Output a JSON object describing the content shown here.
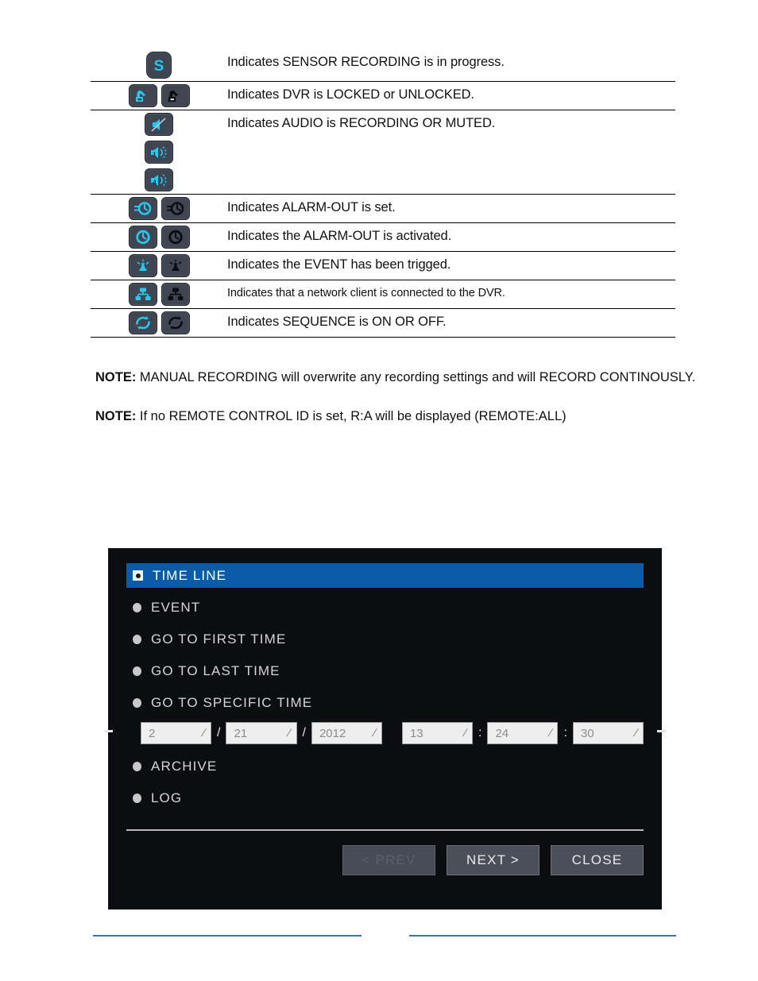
{
  "icon_table": {
    "rows": [
      {
        "id": "sensor-recording",
        "description": "Indicates SENSOR RECORDING is in progress.",
        "icons": [
          "sensor-s-icon"
        ]
      },
      {
        "id": "dvr-lock",
        "description": "Indicates DVR is LOCKED or UNLOCKED.",
        "icons": [
          "lock-locked-icon",
          "lock-unlocked-icon"
        ]
      },
      {
        "id": "audio-state",
        "description": "Indicates AUDIO is RECORDING OR MUTED.",
        "icons": [
          "audio-muted-slash-icon",
          "audio-channel-1-icon",
          "audio-channel-4-icon"
        ]
      },
      {
        "id": "alarm-out-set",
        "description": "Indicates ALARM-OUT is set.",
        "icons": [
          "alarm-out-set-active-icon",
          "alarm-out-set-inactive-icon"
        ]
      },
      {
        "id": "alarm-out-activated",
        "description": "Indicates the ALARM-OUT is activated.",
        "icons": [
          "alarm-clock-active-icon",
          "alarm-clock-inactive-icon"
        ]
      },
      {
        "id": "event-triggered",
        "description": "Indicates the EVENT has been trigged.",
        "icons": [
          "event-siren-active-icon",
          "event-siren-inactive-icon"
        ]
      },
      {
        "id": "network-client",
        "description": "Indicates that a network client is connected to the DVR.",
        "icons": [
          "network-active-icon",
          "network-inactive-icon"
        ]
      },
      {
        "id": "sequence",
        "description": "Indicates SEQUENCE is ON OR OFF.",
        "icons": [
          "sequence-on-icon",
          "sequence-off-icon"
        ]
      }
    ]
  },
  "notes": {
    "note_label": "NOTE:",
    "note_1_text": " MANUAL RECORDING will overwrite any recording settings and will RECORD CONTINOUSLY.",
    "note_2_text": " If no REMOTE CONTROL ID is set, R:A will be displayed (REMOTE:ALL)"
  },
  "dvr_dialog": {
    "menu_items": [
      {
        "label": "TIME LINE",
        "selected": true
      },
      {
        "label": "EVENT",
        "selected": false
      },
      {
        "label": "GO TO FIRST TIME",
        "selected": false
      },
      {
        "label": "GO TO LAST TIME",
        "selected": false
      },
      {
        "label": "GO TO SPECIFIC TIME",
        "selected": false
      },
      {
        "label": "ARCHIVE",
        "selected": false
      },
      {
        "label": "LOG",
        "selected": false
      }
    ],
    "specific_time": {
      "month": "2",
      "day": "21",
      "year": "2012",
      "hour": "13",
      "minute": "24",
      "second": "30",
      "date_separator": "/",
      "time_separator": ":",
      "spin_glyph": "∕"
    },
    "buttons": {
      "prev": "< PREV",
      "next": "NEXT >",
      "close": "CLOSE"
    },
    "colors": {
      "selection_blue": "#0b5ca8",
      "panel_background": "#0c0d10",
      "button_face": "#4a4f59"
    }
  },
  "footer": {
    "rule_color": "#3f73ad"
  }
}
